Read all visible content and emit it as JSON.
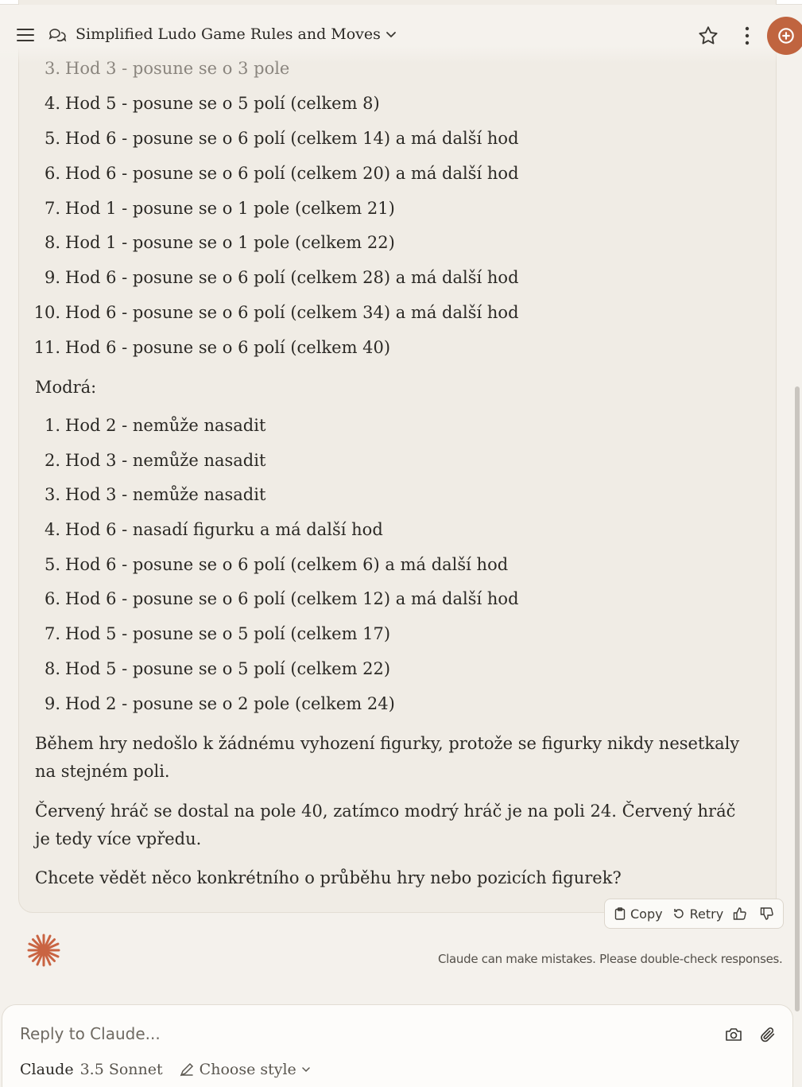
{
  "header": {
    "menu_icon": "hamburger-icon",
    "chat_icon": "chat-bubbles-icon",
    "title": "Simplified Ludo Game Rules and Moves",
    "star_icon": "star-icon",
    "more_icon": "vertical-dots-icon",
    "new_chat_icon": "new-chat-icon",
    "accent_color": "#c0643f"
  },
  "red_moves": [
    {
      "num": "3.",
      "text": "Hod 3 - posune se o 3 pole"
    },
    {
      "num": "4.",
      "text": "Hod 5 - posune se o 5 polí (celkem 8)"
    },
    {
      "num": "5.",
      "text": "Hod 6 - posune se o 6 polí (celkem 14) a má další hod"
    },
    {
      "num": "6.",
      "text": "Hod 6 - posune se o 6 polí (celkem 20) a má další hod"
    },
    {
      "num": "7.",
      "text": "Hod 1 - posune se o 1 pole (celkem 21)"
    },
    {
      "num": "8.",
      "text": "Hod 1 - posune se o 1 pole (celkem 22)"
    },
    {
      "num": "9.",
      "text": "Hod 6 - posune se o 6 polí (celkem 28) a má další hod"
    },
    {
      "num": "10.",
      "text": "Hod 6 - posune se o 6 polí (celkem 34) a má další hod"
    },
    {
      "num": "11.",
      "text": "Hod 6 - posune se o 6 polí (celkem 40)"
    }
  ],
  "blue_heading": "Modrá:",
  "blue_moves": [
    {
      "num": "1.",
      "text": "Hod 2 - nemůže nasadit"
    },
    {
      "num": "2.",
      "text": "Hod 3 - nemůže nasadit"
    },
    {
      "num": "3.",
      "text": "Hod 3 - nemůže nasadit"
    },
    {
      "num": "4.",
      "text": "Hod 6 - nasadí figurku a má další hod"
    },
    {
      "num": "5.",
      "text": "Hod 6 - posune se o 6 polí (celkem 6) a má další hod"
    },
    {
      "num": "6.",
      "text": "Hod 6 - posune se o 6 polí (celkem 12) a má další hod"
    },
    {
      "num": "7.",
      "text": "Hod 5 - posune se o 5 polí (celkem 17)"
    },
    {
      "num": "8.",
      "text": "Hod 5 - posune se o 5 polí (celkem 22)"
    },
    {
      "num": "9.",
      "text": "Hod 2 - posune se o 2 pole (celkem 24)"
    }
  ],
  "paragraphs": [
    "Během hry nedošlo k žádnému vyhození figurky, protože se figurky nikdy nesetkaly na stejném poli.",
    "Červený hráč se dostal na pole 40, zatímco modrý hráč je na poli 24. Červený hráč je tedy více vpředu.",
    "Chcete vědět něco konkrétního o průběhu hry nebo pozicích figurek?"
  ],
  "actions": {
    "copy": "Copy",
    "retry": "Retry",
    "thumbs_up_icon": "thumbs-up-icon",
    "thumbs_down_icon": "thumbs-down-icon"
  },
  "disclaimer": "Claude can make mistakes. Please double-check responses.",
  "composer": {
    "placeholder": "Reply to Claude...",
    "camera_icon": "camera-icon",
    "attach_icon": "paperclip-icon",
    "model_name": "Claude",
    "model_version": "3.5 Sonnet",
    "style_label": "Choose style"
  }
}
